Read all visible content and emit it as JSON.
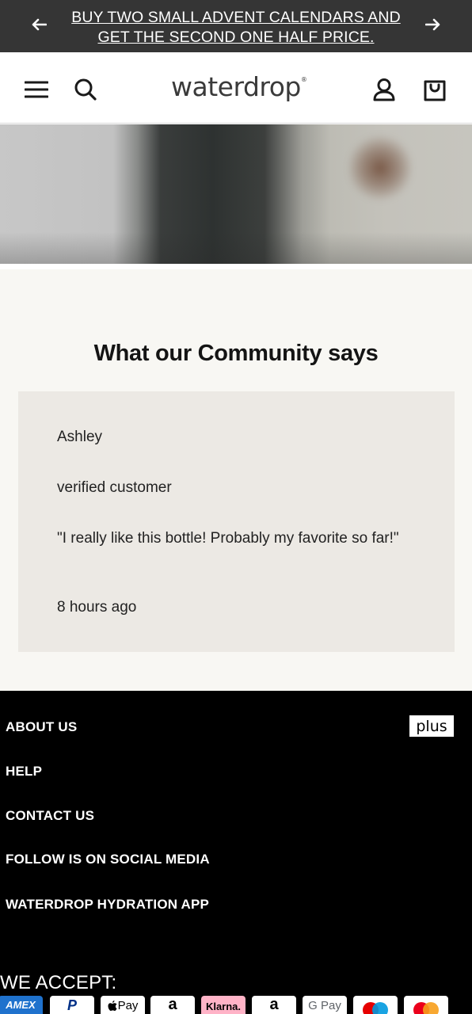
{
  "announcement": {
    "text": "BUY TWO SMALL ADVENT CALENDARS AND GET THE SECOND ONE HALF PRICE.",
    "prev_icon": "arrow-left-icon",
    "next_icon": "arrow-right-icon"
  },
  "header": {
    "logo": "waterdrop",
    "logo_mark": "®",
    "icons": [
      "menu-icon",
      "search-icon",
      "account-icon",
      "cart-icon"
    ]
  },
  "community": {
    "title": "What our Community says",
    "review": {
      "name": "Ashley",
      "badge": "verified customer",
      "text": "\"I really like this bottle! Probably my favorite so far!\"",
      "time": "8 hours ago"
    }
  },
  "footer": {
    "links": [
      "ABOUT US",
      "HELP",
      "CONTACT US",
      "FOLLOW IS ON SOCIAL MEDIA",
      "WATERDROP HYDRATION APP"
    ],
    "plus_badge": "plus",
    "accept_label": "WE ACCEPT:",
    "payments": [
      "AMEX",
      "P",
      "Pay",
      "a",
      "Klarna.",
      "a",
      "G Pay"
    ],
    "payment_icons": [
      "amex-icon",
      "paypal-icon",
      "apple-pay-icon",
      "amazon-pay-icon",
      "klarna-icon",
      "amazon-icon",
      "google-pay-icon",
      "maestro-icon",
      "mastercard-icon"
    ]
  },
  "colors": {
    "announcement_bg": "#353535",
    "community_bg": "#f8f7f3",
    "card_bg": "#ece9e4",
    "footer_bg": "#000000",
    "amex_blue": "#1f72cd",
    "klarna_pink": "#ffb3c7"
  }
}
